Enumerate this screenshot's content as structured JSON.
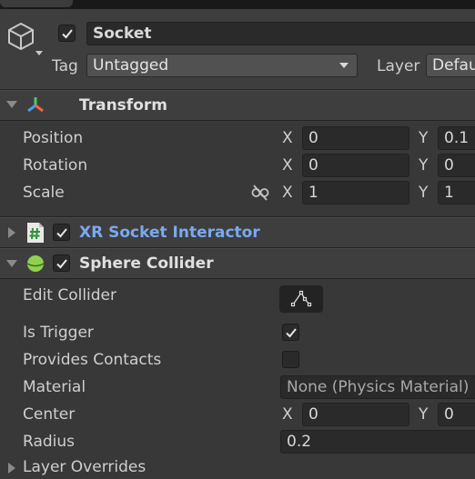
{
  "gameobject": {
    "name": "Socket",
    "active": true,
    "tag_label": "Tag",
    "tag_value": "Untagged",
    "layer_label": "Layer",
    "layer_value": "Defau"
  },
  "transform": {
    "title": "Transform",
    "position": {
      "label": "Position",
      "x": "0",
      "y": "0.1"
    },
    "rotation": {
      "label": "Rotation",
      "x": "0",
      "y": "0"
    },
    "scale": {
      "label": "Scale",
      "x": "1",
      "y": "1"
    },
    "axis_x": "X",
    "axis_y": "Y"
  },
  "xr_socket": {
    "title": "XR Socket Interactor",
    "enabled": true,
    "icon": "script-hash-icon"
  },
  "sphere_collider": {
    "title": "Sphere Collider",
    "enabled": true,
    "edit_collider_label": "Edit Collider",
    "is_trigger_label": "Is Trigger",
    "is_trigger": true,
    "provides_contacts_label": "Provides Contacts",
    "provides_contacts": false,
    "material_label": "Material",
    "material_value": "None (Physics Material)",
    "center_label": "Center",
    "center_x": "0",
    "center_y": "0",
    "radius_label": "Radius",
    "radius_value": "0.2",
    "layer_overrides_label": "Layer Overrides"
  },
  "colors": {
    "background": "#383838",
    "header": "#3e3e3e",
    "field": "#2a2a2a",
    "link": "#7aa9ef",
    "collider_green": "#8fd14f"
  }
}
